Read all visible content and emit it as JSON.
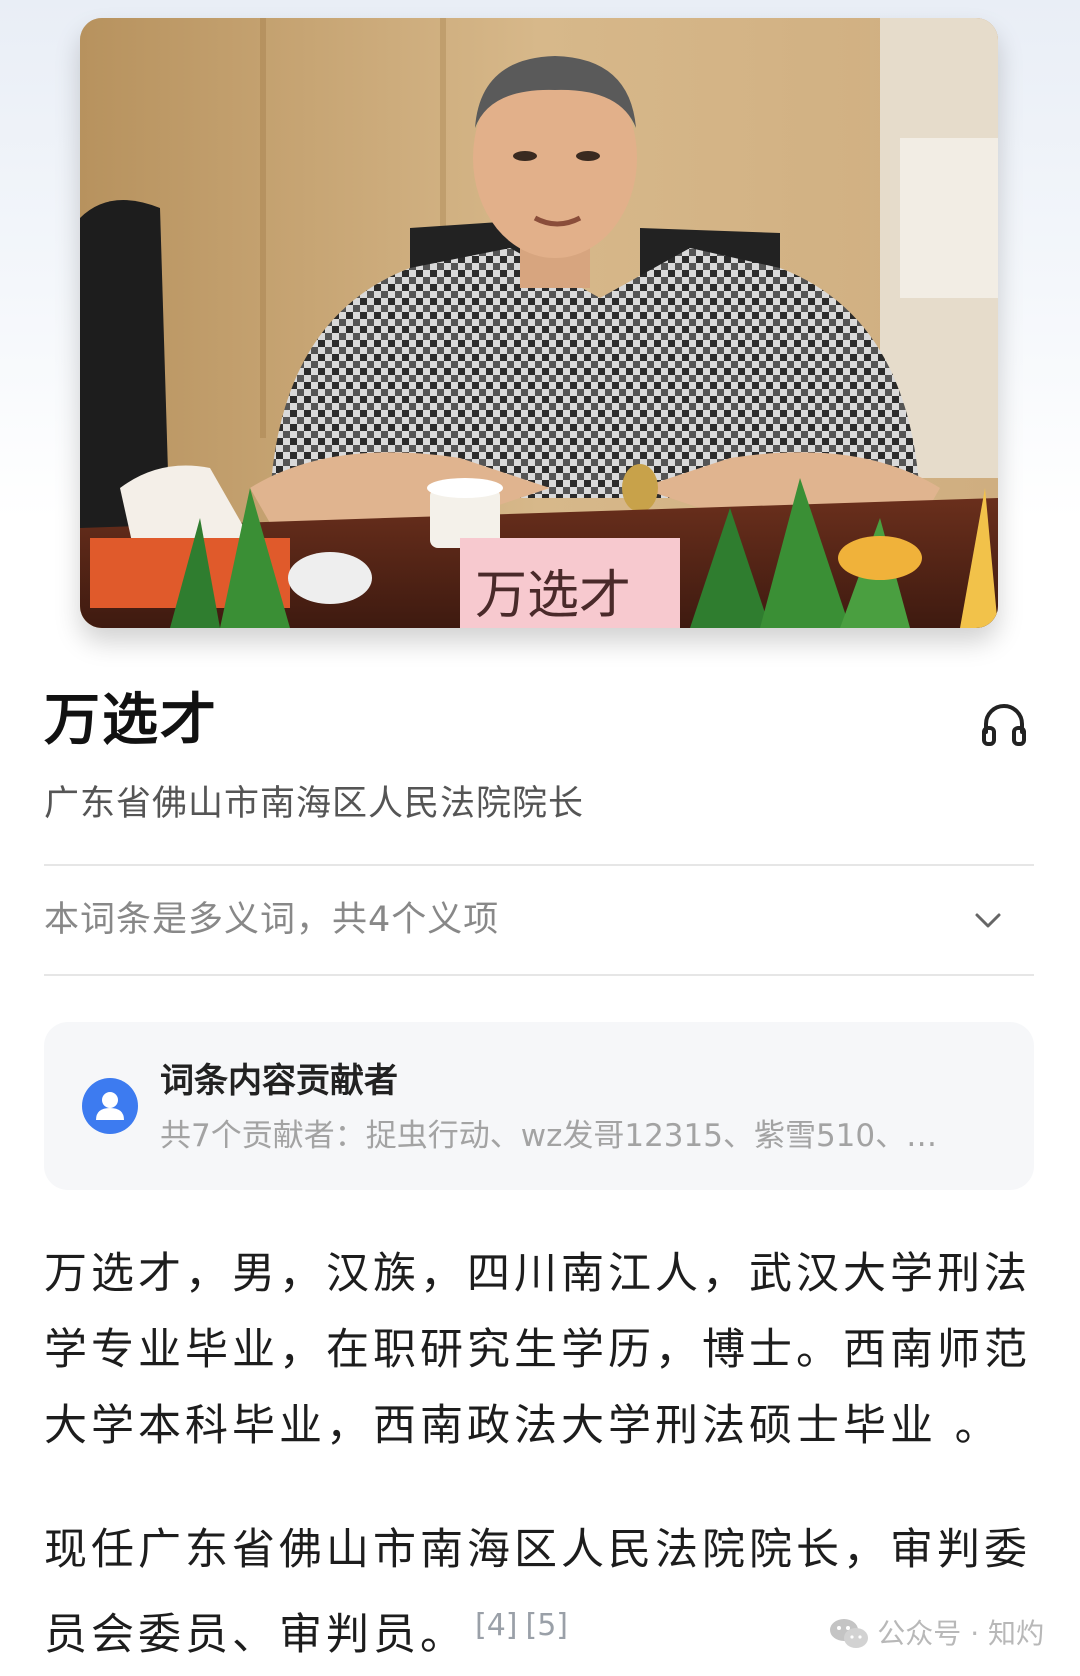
{
  "entry": {
    "title": "万选才",
    "subtitle": "广东省佛山市南海区人民法院院长"
  },
  "photo": {
    "nameplate_text": "万选才"
  },
  "polysemy": {
    "text": "本词条是多义词，共4个义项"
  },
  "contributors": {
    "title": "词条内容贡献者",
    "list_text": "共7个贡献者：捉虫行动、wz发哥12315、紫雪510、…"
  },
  "summary": {
    "paragraph1": "万选才，男，汉族，四川南江人，武汉大学刑法学专业毕业，在职研究生学历，博士。西南师范大学本科毕业，西南政法大学刑法硕士毕业 。",
    "paragraph2": "现任广东省佛山市南海区人民法院院长，审判委员会委员、审判员。",
    "refs": [
      "[4]",
      "[5]"
    ]
  },
  "watermark": {
    "text": "公众号 · 知灼"
  },
  "icons": {
    "audio": "headphone-icon",
    "expand": "chevron-down-icon",
    "avatar": "user-avatar-icon",
    "watermark": "wechat-icon"
  },
  "colors": {
    "accent_blue": "#3d7bf0",
    "muted_text": "#888888",
    "card_bg": "#f6f7f9"
  }
}
